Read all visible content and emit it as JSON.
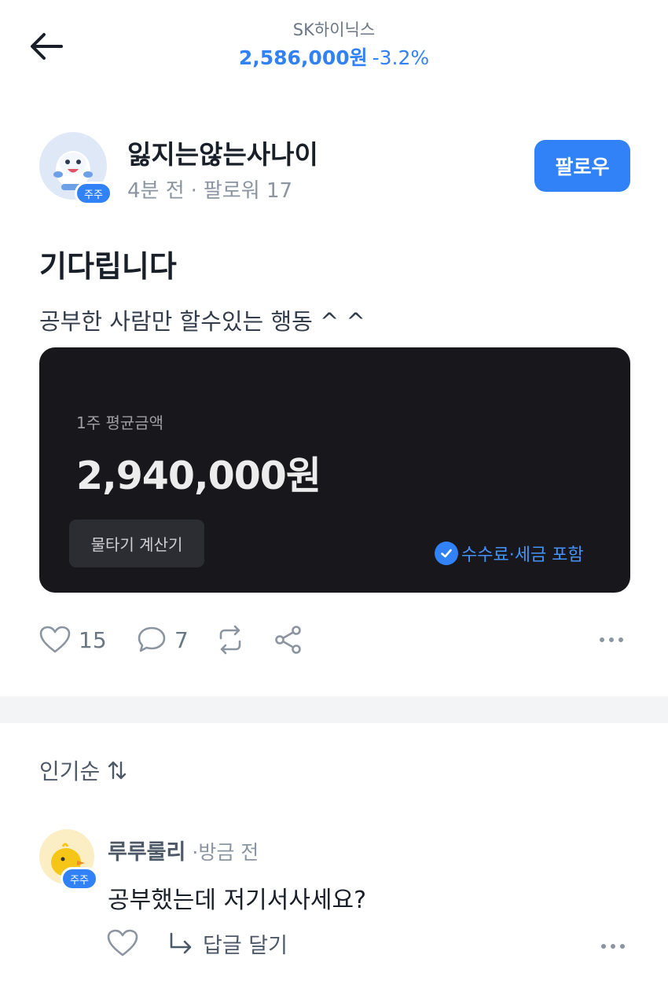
{
  "header": {
    "stock_name": "SK하이닉스",
    "price": "2,586,000원",
    "change": "-3.2%"
  },
  "post": {
    "author_name": "잃지는않는사나이",
    "badge": "주주",
    "time": "4분 전",
    "separator": "·",
    "followers": "팔로워 17",
    "follow_label": "팔로우",
    "title": "기다립니다",
    "text": "공부한 사람만 할수있는 행동  ^ ^",
    "card": {
      "label": "1주 평균금액",
      "amount": "2,940,000원",
      "calc_button": "물타기 계산기",
      "note": "수수료·세금 포함"
    },
    "actions": {
      "likes": "15",
      "comments": "7"
    }
  },
  "sort_label": "인기순",
  "comment": {
    "author": "루루룰리",
    "time": "·방금 전",
    "badge": "주주",
    "text": "공부했는데 저기서사세요?",
    "reply_label": "답글 달기"
  },
  "colors": {
    "accent": "#3182f6",
    "card_bg": "#17171c",
    "muted": "#8b95a1"
  },
  "icons": [
    "back-arrow-icon",
    "heart-icon",
    "comment-icon",
    "repost-icon",
    "share-icon",
    "more-icon",
    "sort-arrows-icon",
    "check-icon",
    "reply-arrow-icon"
  ]
}
